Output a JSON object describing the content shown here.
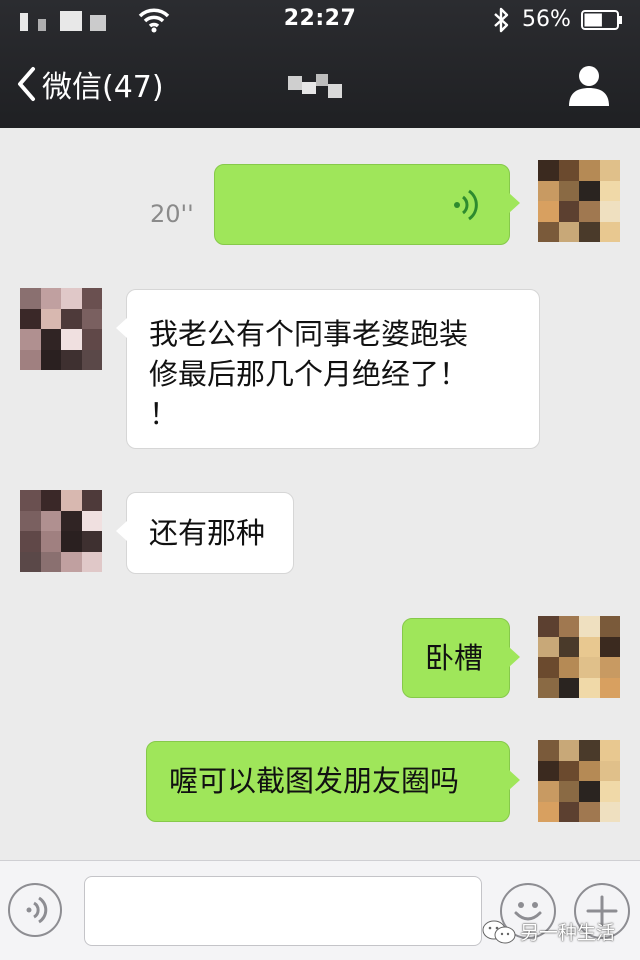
{
  "status_bar": {
    "time": "22:27",
    "battery_percent": "56%",
    "battery_level": 0.56
  },
  "header": {
    "back_label": "微信(47)",
    "title_redacted": true
  },
  "messages": [
    {
      "side": "right",
      "type": "voice",
      "duration": "20''"
    },
    {
      "side": "left",
      "type": "text",
      "lines": [
        "我老公有个同事老婆跑装",
        "修最后那几个月绝经了！",
        "！"
      ]
    },
    {
      "side": "left",
      "type": "text",
      "lines": [
        "还有那种"
      ]
    },
    {
      "side": "right",
      "type": "text",
      "lines": [
        "卧槽"
      ]
    },
    {
      "side": "right",
      "type": "text",
      "lines": [
        "喔可以截图发朋友圈吗"
      ]
    }
  ],
  "input_bar": {
    "placeholder": ""
  },
  "watermark": {
    "text": "另一种生活"
  },
  "colors": {
    "sent_bubble": "#9fe65a",
    "received_bubble": "#ffffff",
    "header_bg": "#26272a",
    "chat_bg": "#ebebeb"
  },
  "icons": [
    "signal-icon",
    "wifi-icon",
    "bluetooth-icon",
    "battery-icon",
    "back-chevron-icon",
    "profile-icon",
    "voice-wave-icon",
    "voice-input-icon",
    "emoji-icon",
    "plus-icon",
    "wechat-logo-icon"
  ]
}
